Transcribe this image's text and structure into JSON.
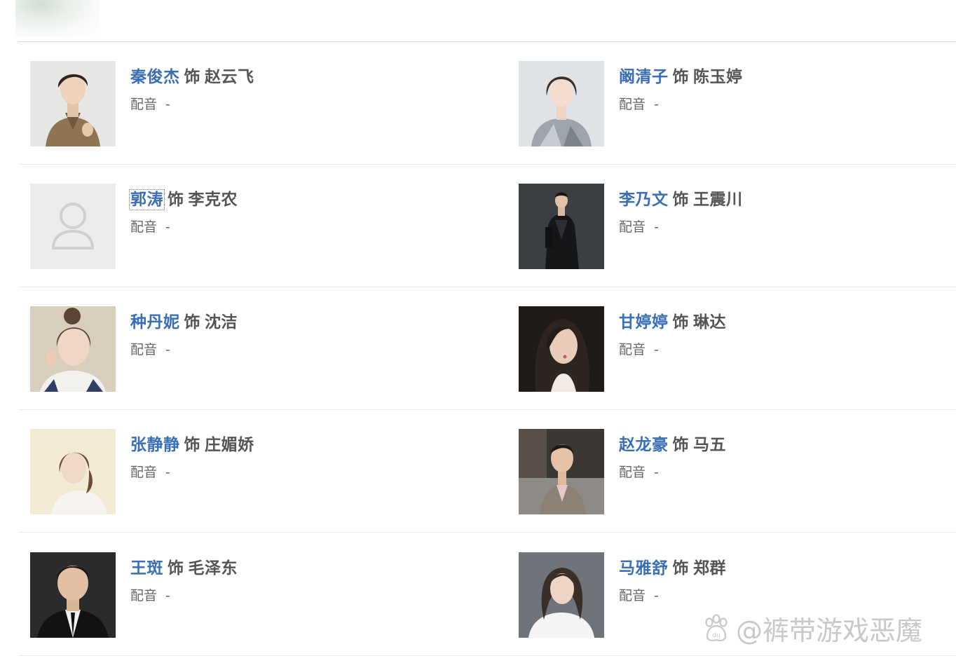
{
  "cast": [
    {
      "actor": "秦俊杰",
      "connector": "饰",
      "role": "赵云飞",
      "voice_label": "配音",
      "voice_value": "-",
      "photo": "man-khaki-shirt"
    },
    {
      "actor": "阚清子",
      "connector": "饰",
      "role": "陈玉婷",
      "voice_label": "配音",
      "voice_value": "-",
      "photo": "woman-bob-hair"
    },
    {
      "actor": "郭涛",
      "connector": "饰",
      "role": "李克农",
      "voice_label": "配音",
      "voice_value": "-",
      "photo": "placeholder-avatar"
    },
    {
      "actor": "李乃文",
      "connector": "饰",
      "role": "王震川",
      "voice_label": "配音",
      "voice_value": "-",
      "photo": "man-dark-suit"
    },
    {
      "actor": "种丹妮",
      "connector": "饰",
      "role": "沈洁",
      "voice_label": "配音",
      "voice_value": "-",
      "photo": "woman-updo"
    },
    {
      "actor": "甘婷婷",
      "connector": "饰",
      "role": "琳达",
      "voice_label": "配音",
      "voice_value": "-",
      "photo": "woman-long-hair"
    },
    {
      "actor": "张静静",
      "connector": "饰",
      "role": "庄媚娇",
      "voice_label": "配音",
      "voice_value": "-",
      "photo": "woman-light-background"
    },
    {
      "actor": "赵龙豪",
      "connector": "饰",
      "role": "马五",
      "voice_label": "配音",
      "voice_value": "-",
      "photo": "man-grey-suit"
    },
    {
      "actor": "王斑",
      "connector": "饰",
      "role": "毛泽东",
      "voice_label": "配音",
      "voice_value": "-",
      "photo": "man-black-suit"
    },
    {
      "actor": "马雅舒",
      "connector": "饰",
      "role": "郑群",
      "voice_label": "配音",
      "voice_value": "-",
      "photo": "woman-white-top"
    }
  ],
  "watermark": {
    "text": "@裤带游戏恶魔",
    "icon": "baidu-paw-icon"
  },
  "colors": {
    "actor_link": "#3a6eb5",
    "text": "#555555",
    "divider": "#ebebeb"
  }
}
